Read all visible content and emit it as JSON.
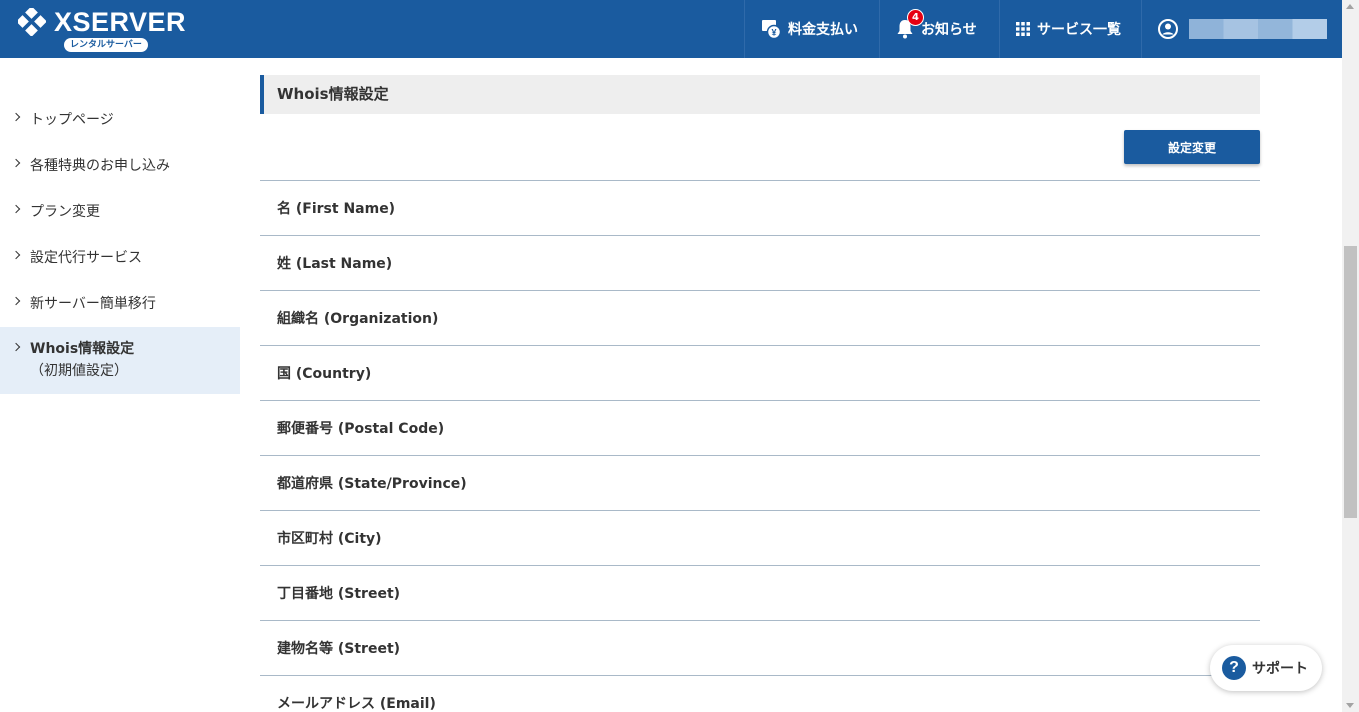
{
  "brand": {
    "name": "XSERVER",
    "badge": "レンタルサーバー",
    "color": "#1a5b9f"
  },
  "header": {
    "nav": [
      {
        "label": "料金支払い",
        "icon": "billing-icon"
      },
      {
        "label": "お知らせ",
        "icon": "bell-icon",
        "badge": "4"
      },
      {
        "label": "サービス一覧",
        "icon": "grid-icon"
      },
      {
        "label": "",
        "icon": "user-icon"
      }
    ]
  },
  "sidebar": {
    "items": [
      {
        "label": "トップページ"
      },
      {
        "label": "各種特典のお申し込み"
      },
      {
        "label": "プラン変更"
      },
      {
        "label": "設定代行サービス"
      },
      {
        "label": "新サーバー簡単移行"
      },
      {
        "label": "Whois情報設定",
        "sub": "（初期値設定）",
        "active": true
      }
    ]
  },
  "main": {
    "section_title": "Whois情報設定",
    "change_button": "設定変更",
    "fields": [
      "名 (First Name)",
      "姓 (Last Name)",
      "組織名 (Organization)",
      "国 (Country)",
      "郵便番号 (Postal Code)",
      "都道府県 (State/Province)",
      "市区町村 (City)",
      "丁目番地 (Street)",
      "建物名等 (Street)",
      "メールアドレス (Email)"
    ]
  },
  "support": {
    "label": "サポート",
    "icon_glyph": "?"
  }
}
